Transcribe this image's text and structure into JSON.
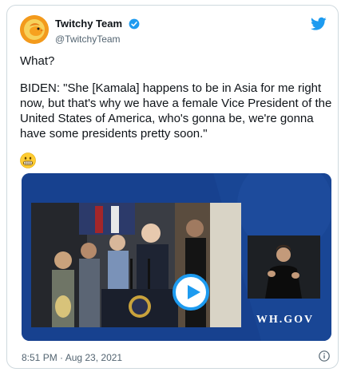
{
  "tweet": {
    "display_name": "Twitchy Team",
    "handle": "@TwitchyTeam",
    "verified": true,
    "paragraphs": [
      "What?",
      "BIDEN: \"She [Kamala] happens to be in Asia for me right now, but that's why we have a female Vice President of the United States of America, who's gonna be, we're gonna have some presidents pretty soon.\""
    ],
    "emoji": "grimacing-face",
    "timestamp": "8:51 PM · Aug 23, 2021"
  },
  "media": {
    "type": "video",
    "watermark": "WH.GOV",
    "colors": {
      "backdrop": "#17418f",
      "play": "#1d9bf0"
    }
  },
  "icons": {
    "brand": "twitter-bird-icon",
    "verified": "verified-badge-icon",
    "info": "info-icon",
    "play": "play-icon"
  },
  "colors": {
    "accent": "#1d9bf0",
    "text": "#0f1419",
    "muted": "#536471",
    "border": "#cfd9de"
  }
}
